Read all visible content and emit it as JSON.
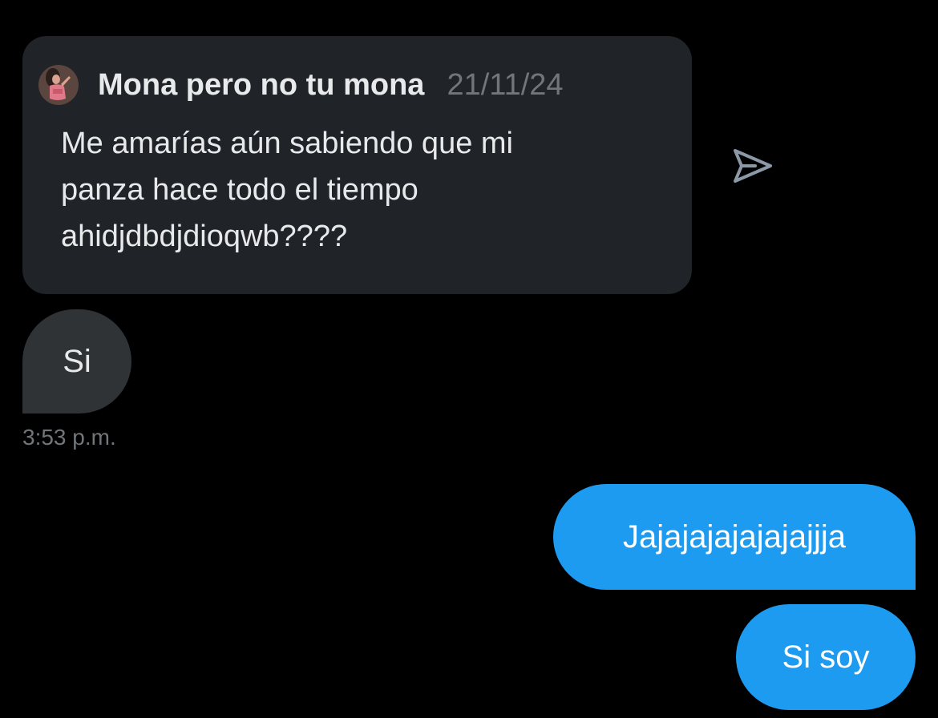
{
  "quoted_message": {
    "author": "Mona pero no tu mona",
    "date": "21/11/24",
    "text_lines": [
      "Me amarías aún sabiendo que mi",
      "panza hace todo el tiempo",
      "ahidjdbdjdioqwb????"
    ],
    "avatar_icon": "profile-photo",
    "share_icon": "send-arrow-icon"
  },
  "received_messages": [
    {
      "text": "Si"
    }
  ],
  "received_timestamp": "3:53 p.m.",
  "sent_messages": [
    {
      "text": "Jajajajajajajajjja"
    },
    {
      "text": "Si soy"
    }
  ],
  "colors": {
    "background": "#000000",
    "quote_card": "#202327",
    "received_bubble": "#2f3336",
    "sent_bubble": "#1d9bf0",
    "muted_text": "#71767b",
    "primary_text": "#e7e9ea"
  }
}
